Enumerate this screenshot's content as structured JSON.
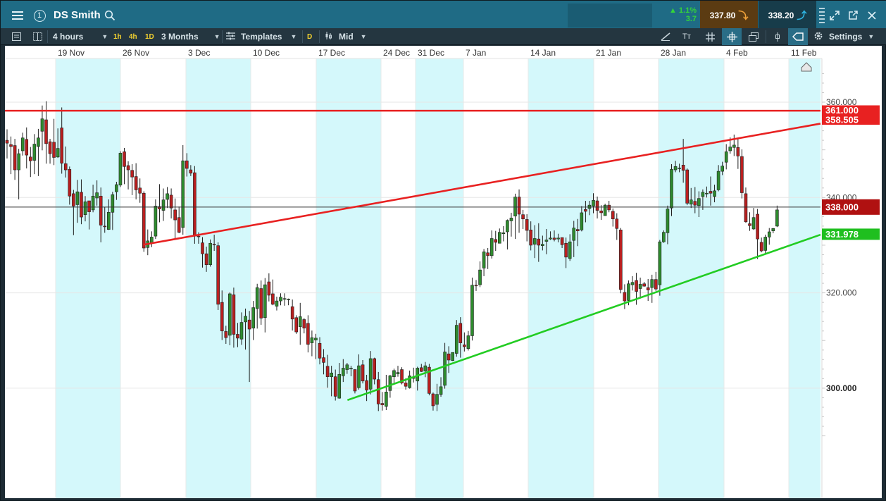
{
  "instrument": {
    "name": "DS Smith"
  },
  "header": {
    "change_pct": "1.1%",
    "change_abs": "3.7",
    "sell_price": "337.80",
    "buy_price": "338.20"
  },
  "toolbar": {
    "interval": "4 hours",
    "quick_1h": "1h",
    "quick_4h": "4h",
    "quick_1d": "1D",
    "range": "3 Months",
    "templates": "Templates",
    "mode_d": "D",
    "price_type": "Mid",
    "text_tool": "Tт",
    "settings": "Settings"
  },
  "colors": {
    "up": "#2e8b2e",
    "down": "#b81f1f",
    "resistance": "#e82121",
    "support": "#22cc22",
    "week_band": "#d4f8fb",
    "current_label": "#b01111"
  },
  "chart_data": {
    "type": "candlestick",
    "ylim": [
      285,
      367
    ],
    "y_ticks": [
      "360.000",
      "340.000",
      "320.000",
      "300.000"
    ],
    "x_ticks": [
      "19 Nov",
      "26 Nov",
      "3 Dec",
      "10 Dec",
      "17 Dec",
      "24 Dec",
      "31 Dec",
      "7 Jan",
      "14 Jan",
      "21 Jan",
      "28 Jan",
      "4 Feb",
      "11 Feb"
    ],
    "price_labels": {
      "level_top": "361.000",
      "resistance_end": "358.505",
      "current": "338.000",
      "support_end": "331.978"
    },
    "current_price": 338.0,
    "horizontal_resistance": 358.2,
    "lines": [
      {
        "name": "resistance",
        "points": [
          [
            0.17,
            330.1
          ],
          [
            1.0,
            355.5
          ]
        ]
      },
      {
        "name": "support",
        "points": [
          [
            0.42,
            297.5
          ],
          [
            1.0,
            332.2
          ]
        ]
      }
    ],
    "candles": [
      [
        352,
        351.4,
        354.3,
        348.2
      ],
      [
        351.1,
        350.7,
        352.8,
        344.9
      ],
      [
        350.9,
        345.8,
        352.3,
        343.7
      ],
      [
        345.8,
        349.2,
        350.2,
        339.6
      ],
      [
        349.8,
        352.5,
        353.6,
        348.8
      ],
      [
        352.2,
        348.9,
        354.7,
        346.1
      ],
      [
        348.5,
        347.7,
        350.6,
        344.3
      ],
      [
        347.8,
        351.2,
        353.3,
        344.9
      ],
      [
        350.7,
        352.5,
        354.4,
        344.5
      ],
      [
        353.9,
        356.5,
        359.3,
        349.9
      ],
      [
        356.3,
        351.3,
        360.2,
        347.1
      ],
      [
        351.7,
        349.2,
        352.3,
        347.1
      ],
      [
        351.6,
        348.4,
        356.5,
        346.8
      ],
      [
        348.5,
        350.3,
        354.5,
        348.3
      ],
      [
        354.6,
        347.2,
        358.9,
        345
      ],
      [
        347.1,
        345.8,
        350.7,
        344.2
      ],
      [
        345.9,
        340.3,
        346.5,
        338.5
      ],
      [
        340.8,
        338.2,
        341.6,
        332.1
      ],
      [
        338.5,
        341.2,
        343.7,
        334.7
      ],
      [
        341.1,
        335.9,
        343.8,
        334.4
      ],
      [
        336.4,
        339.1,
        340.3,
        335
      ],
      [
        339.3,
        337,
        339.3,
        333.3
      ],
      [
        337.4,
        340.3,
        342.7,
        336.9
      ],
      [
        339.9,
        341,
        343.6,
        338.3
      ],
      [
        340.3,
        334.2,
        342.1,
        330.6
      ],
      [
        334,
        333.9,
        338,
        332.6
      ],
      [
        333.3,
        336.9,
        339.6,
        333.2
      ],
      [
        336.9,
        340.6,
        341.2,
        333.2
      ],
      [
        341.2,
        342.7,
        343.3,
        339.5
      ],
      [
        342.6,
        349.3,
        349.7,
        342.2
      ],
      [
        349.6,
        346.5,
        350.4,
        342.8
      ],
      [
        346.7,
        345.8,
        347.6,
        341.7
      ],
      [
        345.7,
        344.3,
        347,
        340.5
      ],
      [
        344.4,
        341.6,
        347.2,
        339.6
      ],
      [
        342,
        340.9,
        344,
        338.9
      ],
      [
        340.9,
        329.4,
        341.3,
        328.6
      ],
      [
        329.5,
        330.9,
        333.3,
        327.9
      ],
      [
        330.4,
        331.7,
        332.9,
        329.6
      ],
      [
        331.9,
        338.2,
        339.6,
        331.3
      ],
      [
        338.1,
        337.6,
        342.8,
        334.8
      ],
      [
        337.3,
        339.5,
        341.9,
        335.1
      ],
      [
        339.6,
        340.8,
        342.2,
        337.8
      ],
      [
        340.5,
        337.8,
        341.9,
        335.6
      ],
      [
        337.4,
        335.3,
        339.8,
        331.2
      ],
      [
        335.8,
        332.7,
        338.1,
        332.5
      ],
      [
        333.7,
        347.7,
        351,
        332.2
      ],
      [
        347.7,
        346.1,
        349.3,
        344.4
      ],
      [
        345.8,
        345.1,
        346.8,
        344.5
      ],
      [
        345.2,
        331.9,
        346.6,
        330.3
      ],
      [
        331.9,
        331.8,
        332.7,
        330.3
      ],
      [
        330.5,
        328.2,
        331.7,
        325.3
      ],
      [
        328.2,
        325.9,
        329.7,
        324.4
      ],
      [
        325.9,
        330.4,
        331.2,
        325.5
      ],
      [
        330.2,
        330.1,
        332.2,
        328.8
      ],
      [
        329.9,
        317.6,
        330.6,
        316.4
      ],
      [
        318,
        312,
        320.5,
        310.1
      ],
      [
        311.9,
        310.6,
        313.1,
        309.3
      ],
      [
        311.1,
        319.8,
        320.1,
        309
      ],
      [
        319.6,
        311.3,
        321.1,
        308.5
      ],
      [
        311.3,
        310.5,
        313.7,
        308.6
      ],
      [
        310.3,
        313.8,
        315.9,
        309.1
      ],
      [
        313.9,
        315.1,
        316.7,
        308.1
      ],
      [
        314.3,
        312.4,
        316.2,
        301.3
      ],
      [
        312.6,
        316.9,
        318.3,
        310.1
      ],
      [
        316.7,
        321.1,
        321.9,
        312.5
      ],
      [
        320.9,
        314.7,
        322.6,
        313.3
      ],
      [
        314.8,
        321.7,
        323.1,
        311.7
      ],
      [
        322.3,
        319.5,
        324.1,
        318.2
      ],
      [
        319.8,
        317.6,
        322.8,
        317.4
      ],
      [
        317.2,
        318.3,
        319.2,
        316.3
      ],
      [
        318.3,
        319.1,
        319.9,
        317.4
      ],
      [
        318.7,
        318.8,
        319.9,
        317.3
      ],
      [
        318.7,
        318.7,
        318.8,
        317.4
      ],
      [
        317.1,
        314.5,
        318.6,
        312.1
      ],
      [
        314.8,
        311.8,
        315.3,
        311.4
      ],
      [
        312.9,
        315,
        317.9,
        309.1
      ],
      [
        314.4,
        312.6,
        314.7,
        311.5
      ],
      [
        313.6,
        309.2,
        315.3,
        307.5
      ],
      [
        309.5,
        310.6,
        312.1,
        306.7
      ],
      [
        310.1,
        310.5,
        311.4,
        306.1
      ],
      [
        309.4,
        306.3,
        310.7,
        305
      ],
      [
        306.4,
        305.4,
        308.2,
        302.9
      ],
      [
        304.6,
        302.4,
        307,
        300.1
      ],
      [
        302.4,
        303.2,
        304.7,
        298.3
      ],
      [
        302.4,
        298.3,
        303.9,
        297.4
      ],
      [
        297.9,
        302.9,
        305.3,
        297.8
      ],
      [
        302.6,
        304.2,
        306.1,
        301.3
      ],
      [
        303.9,
        304.9,
        305.3,
        303
      ],
      [
        304.2,
        304.2,
        304.7,
        302.5
      ],
      [
        303.9,
        299.4,
        304,
        298.9
      ],
      [
        300.1,
        304.7,
        307.1,
        299.7
      ],
      [
        304.9,
        301.5,
        305.9,
        301
      ],
      [
        301.6,
        299.6,
        302.8,
        297.3
      ],
      [
        299.8,
        306.2,
        307.8,
        298.7
      ],
      [
        306.2,
        301.9,
        306.4,
        300.8
      ],
      [
        301.8,
        296.7,
        303.4,
        295.2
      ],
      [
        296.8,
        296.5,
        299.2,
        295.3
      ],
      [
        296.2,
        299.2,
        302.8,
        295.4
      ],
      [
        299.5,
        302.6,
        302.8,
        298
      ],
      [
        302.4,
        303.7,
        304.1,
        301.1
      ],
      [
        303,
        303.3,
        304.7,
        302.4
      ],
      [
        303.9,
        301.1,
        304.4,
        300.8
      ],
      [
        301.1,
        300.4,
        302.1,
        299.7
      ],
      [
        300.1,
        302.6,
        303.7,
        299.9
      ],
      [
        302.2,
        302.1,
        304.3,
        301.2
      ],
      [
        301.5,
        304.2,
        304.5,
        299.5
      ],
      [
        304.3,
        303.5,
        305.1,
        303.4
      ],
      [
        303.6,
        304.7,
        305.5,
        302.3
      ],
      [
        304.4,
        298.9,
        305.1,
        298.5
      ],
      [
        298.8,
        296.3,
        299.1,
        295.3
      ],
      [
        296.6,
        298.7,
        300.9,
        295.2
      ],
      [
        298.7,
        300.3,
        302.3,
        298.2
      ],
      [
        300.6,
        307.6,
        309.5,
        299.9
      ],
      [
        307.2,
        305.9,
        308.8,
        303.2
      ],
      [
        305.8,
        307.5,
        307.5,
        305.7
      ],
      [
        307.3,
        313.2,
        314.3,
        306.6
      ],
      [
        313.6,
        309.5,
        314.9,
        306.4
      ],
      [
        309.1,
        308.7,
        311.7,
        307.7
      ],
      [
        308.3,
        311,
        312,
        307.9
      ],
      [
        311,
        321.6,
        323.2,
        310
      ],
      [
        321.6,
        321.5,
        322.7,
        320.4
      ],
      [
        321.7,
        324.8,
        326.6,
        321.2
      ],
      [
        325.2,
        328.6,
        329.2,
        323.5
      ],
      [
        328.4,
        327.8,
        329.4,
        325
      ],
      [
        327.8,
        331.4,
        333.1,
        327.2
      ],
      [
        331.2,
        330.6,
        333,
        328.8
      ],
      [
        330.4,
        332.7,
        333.5,
        330.4
      ],
      [
        332.4,
        332.6,
        334,
        330.8
      ],
      [
        332.8,
        335.2,
        335.4,
        329.1
      ],
      [
        335.1,
        335.7,
        336.8,
        331.8
      ],
      [
        336.1,
        340.1,
        340.8,
        331.3
      ],
      [
        340.1,
        336.5,
        341.7,
        332.6
      ],
      [
        336.4,
        335.5,
        337.4,
        333.4
      ],
      [
        335.4,
        333.1,
        336.5,
        330.8
      ],
      [
        333.2,
        330,
        335,
        328.9
      ],
      [
        330.2,
        331.4,
        334.2,
        327.3
      ],
      [
        331.3,
        330,
        334.6,
        326.5
      ],
      [
        329.9,
        330.2,
        332,
        328.9
      ],
      [
        330.8,
        331.1,
        333.4,
        328.1
      ],
      [
        331.3,
        331.5,
        332.9,
        331.1
      ],
      [
        331.5,
        331.2,
        333.1,
        330.8
      ],
      [
        331.3,
        331.5,
        332.4,
        330.6
      ],
      [
        331.6,
        330.1,
        331.6,
        329.4
      ],
      [
        330.4,
        327.5,
        331.6,
        325.2
      ],
      [
        327.2,
        330.7,
        332.3,
        326.7
      ],
      [
        331,
        333.6,
        335.1,
        327.5
      ],
      [
        333.3,
        333,
        335.5,
        329.8
      ],
      [
        333.2,
        336.8,
        338.2,
        332.9
      ],
      [
        337.5,
        337.1,
        339.3,
        334.8
      ],
      [
        337.7,
        338.4,
        339.3,
        336.3
      ],
      [
        338.2,
        339.4,
        340.9,
        336.7
      ],
      [
        339.3,
        337.3,
        340.2,
        335.6
      ],
      [
        337.2,
        336.8,
        338.4,
        335.3
      ],
      [
        336.2,
        338.4,
        338.7,
        336.2
      ],
      [
        338.4,
        337.4,
        339.3,
        336.9
      ],
      [
        337.1,
        335.5,
        337.7,
        333.9
      ],
      [
        335.5,
        333.5,
        336.7,
        331.1
      ],
      [
        333.2,
        320.7,
        333.6,
        319.9
      ],
      [
        320.1,
        318.3,
        321.8,
        316.6
      ],
      [
        318.4,
        321.9,
        322.6,
        317.4
      ],
      [
        321.7,
        322.2,
        323.5,
        320.5
      ],
      [
        322.6,
        320.3,
        324.2,
        317.5
      ],
      [
        320.9,
        321.8,
        323.2,
        318.8
      ],
      [
        321.9,
        321.4,
        322.3,
        321.3
      ],
      [
        321.1,
        320.6,
        322.9,
        318.3
      ],
      [
        321.1,
        322.8,
        323.8,
        317.9
      ],
      [
        322.8,
        320.8,
        324.4,
        320.4
      ],
      [
        321.7,
        330.7,
        331.1,
        319.4
      ],
      [
        330.7,
        332.7,
        333.1,
        330.5
      ],
      [
        332.6,
        337.6,
        338.3,
        330.2
      ],
      [
        337.8,
        345.9,
        347,
        336.1
      ],
      [
        345.8,
        346.5,
        347.7,
        345.3
      ],
      [
        346.2,
        346.2,
        347.1,
        345.3
      ],
      [
        346.8,
        345.7,
        352.3,
        343.1
      ],
      [
        345.8,
        338.8,
        346.1,
        338.4
      ],
      [
        338.6,
        339.5,
        342,
        337.8
      ],
      [
        339.2,
        338.4,
        342.2,
        336.7
      ],
      [
        338.3,
        339.8,
        341.3,
        335.9
      ],
      [
        340.2,
        341.1,
        341.7,
        337.4
      ],
      [
        340.9,
        340.9,
        342.3,
        340
      ],
      [
        341.3,
        340.9,
        344.4,
        338.3
      ],
      [
        340.2,
        341.4,
        342.7,
        339
      ],
      [
        341.6,
        345.5,
        346.8,
        341.3
      ],
      [
        345.5,
        346.6,
        347.5,
        344.7
      ],
      [
        347.4,
        349.6,
        351.2,
        345.9
      ],
      [
        349.8,
        350.6,
        352.6,
        349.2
      ],
      [
        350.5,
        351,
        353.2,
        348.7
      ],
      [
        350.5,
        348.7,
        352.4,
        346
      ],
      [
        348.6,
        341,
        350.1,
        339.8
      ],
      [
        340.8,
        334.9,
        342.1,
        334.7
      ],
      [
        334.5,
        334.1,
        336.9,
        333
      ],
      [
        333.4,
        335.8,
        337.8,
        333.2
      ],
      [
        336.5,
        331.3,
        337.6,
        327.1
      ],
      [
        330.6,
        328.8,
        331.6,
        328.5
      ],
      [
        328.9,
        331.7,
        332.2,
        328.2
      ],
      [
        331.7,
        332.8,
        333.6,
        330.1
      ],
      [
        333,
        333.5,
        333.6,
        332.5
      ],
      [
        334,
        337.4,
        338.3,
        333.8
      ]
    ]
  }
}
